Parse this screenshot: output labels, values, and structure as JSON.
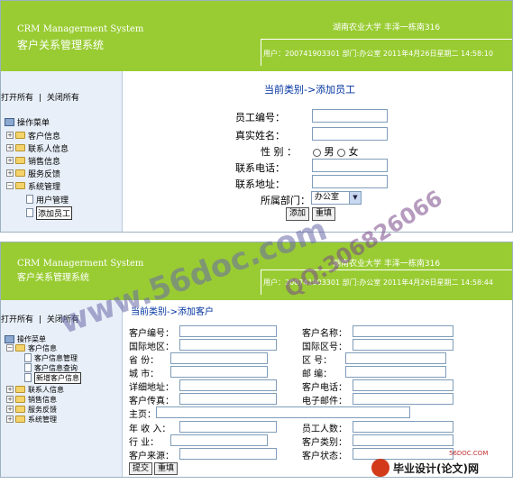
{
  "header": {
    "system_en": "CRM Managerment System",
    "system_cn": "客户关系管理系统",
    "organization": "湖南农业大学 丰泽一栋南316",
    "user_info_1": "用户：2007419033​01 部门:办公室  2011年4月26日星期二  14:58:10",
    "user_info_2": "用户：200741903301 部门:办公室  2011年4月26日星期二  14:58:44"
  },
  "sidebar": {
    "open_all": "打开所有",
    "separator": "|",
    "close_all": "关闭所有",
    "root": "操作菜单",
    "menu1": {
      "customer_info": "客户信息",
      "contact_info": "联系人信息",
      "sales_info": "销售信息",
      "service_feedback": "服务反馈",
      "system_management": "系统管理",
      "user_management": "用户管理",
      "add_employee": "添加员工"
    },
    "menu2": {
      "customer_info": "客户信息",
      "customer_info_mgmt": "客户信息管理",
      "customer_info_query": "客户信息查询",
      "add_customer_info": "新增客户信息",
      "contact_info": "联系人信息",
      "sales_info": "销售信息",
      "service_feedback": "服务反馈",
      "system_management": "系统管理"
    }
  },
  "employee_form": {
    "title": "当前类别->添加员工",
    "employee_no": "员工编号：",
    "real_name": "真实姓名：",
    "gender": "性    别  ：",
    "male": "男",
    "female": "女",
    "phone": "联系电话：",
    "address": "联系地址：",
    "department": "所属部门：",
    "department_value": "办公室",
    "add_button": "添加",
    "reset_button": "重填"
  },
  "customer_form": {
    "title": "当前类别->添加客户",
    "customer_no": "客户编号：",
    "customer_name": "客户名称：",
    "country": "国际地区：",
    "country_code": "国际区号：",
    "province": "省    份：",
    "area_code": "区    号：",
    "city": "城    市：",
    "postcode": "邮    编：",
    "address": "详细地址：",
    "customer_phone": "客户电话：",
    "customer_fax": "客户传真：",
    "email": "电子邮件：",
    "homepage": "主页：",
    "annual_revenue": "年 收 入：",
    "employee_count": "员工人数：",
    "industry": "行    业：",
    "customer_category": "客户类别：",
    "customer_source": "客户来源：",
    "customer_status": "客户状态：",
    "submit_button": "提交",
    "reset_button": "重填"
  },
  "watermark": {
    "site": "www.56doc.com",
    "qq": "QQ:306826066"
  },
  "logo": {
    "small": "56DOC.COM",
    "text": "毕业设计(论文)网"
  }
}
